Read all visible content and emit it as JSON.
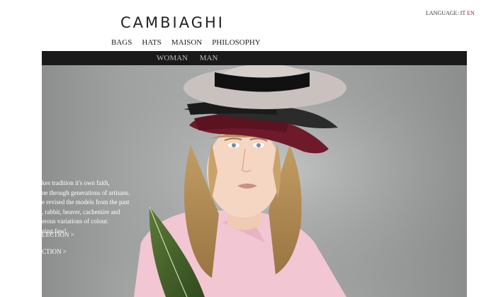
{
  "brand": {
    "logo_text": "CAMBIAGHI"
  },
  "language": {
    "label": "LANGUAGE:",
    "it": "IT",
    "en": "EN"
  },
  "main_nav": {
    "items": [
      {
        "label": "BAGS"
      },
      {
        "label": "HATS"
      },
      {
        "label": "MAISON"
      },
      {
        "label": "PHILOSOPHY"
      }
    ]
  },
  "sub_nav": {
    "items": [
      {
        "label": "WOMAN"
      },
      {
        "label": "MAN"
      }
    ]
  },
  "hero": {
    "text_lines": [
      "kes tradition it's own faith,",
      "ne through generations of artisans.",
      "e revised the models from the past",
      ", rabbit, beaver, cachemire and",
      "erous variations of colour.",
      "ning few!"
    ],
    "links": [
      {
        "label": "LECTION >"
      },
      {
        "label": "CTION >"
      }
    ]
  },
  "colors": {
    "accent": "#9b1a36",
    "bar": "#1a1a1a",
    "nav_text": "#222222"
  }
}
